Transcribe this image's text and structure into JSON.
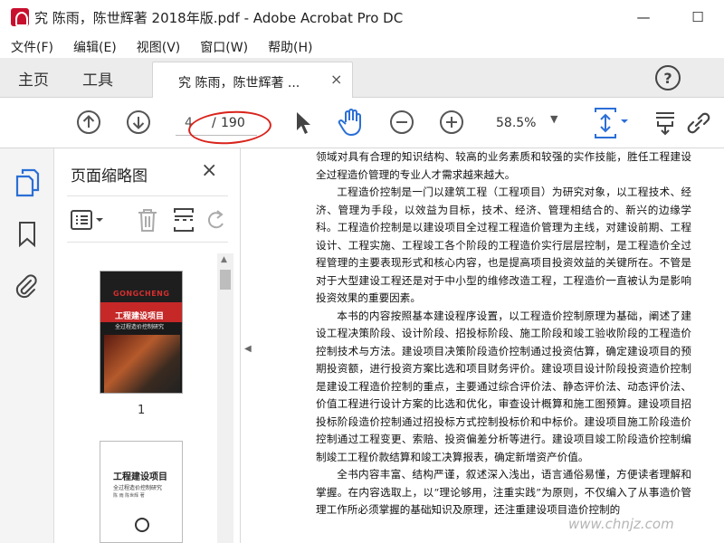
{
  "window": {
    "title": "究 陈雨，陈世辉著 2018年版.pdf - Adobe Acrobat Pro DC",
    "minimize": "—",
    "maximize": "☐"
  },
  "menu": [
    "文件(F)",
    "编辑(E)",
    "视图(V)",
    "窗口(W)",
    "帮助(H)"
  ],
  "tabs": {
    "home": "主页",
    "tools": "工具",
    "document": "究 陈雨，陈世辉著 ...",
    "close": "×",
    "help": "?"
  },
  "toolbar": {
    "page_current": "4",
    "page_separator": "/",
    "page_total": "190",
    "zoom": "58.5%",
    "zoom_caret": "▼"
  },
  "thumbnails": {
    "title": "页面缩略图",
    "close": "×",
    "page1_label": "1",
    "page1": {
      "brand": "GONGCHENG",
      "title": "工程建设项目",
      "subtitle": "全过程造价控制研究"
    },
    "page2": {
      "title": "工程建设项目",
      "subtitle": "全过程造价控制研究",
      "authors": "陈 雨  陈世辉 著"
    }
  },
  "document": {
    "paragraphs": [
      {
        "indent": false,
        "text": "领域对具有合理的知识结构、较高的业务素质和较强的实作技能，胜任工程建设全过程造价管理的专业人才需求越来越大。"
      },
      {
        "indent": true,
        "text": "工程造价控制是一门以建筑工程（工程项目）为研究对象，以工程技术、经济、管理为手段，以效益为目标，技术、经济、管理相结合的、新兴的边缘学科。工程造价控制是以建设项目全过程工程造价管理为主线，对建设前期、工程设计、工程实施、工程竣工各个阶段的工程造价实行层层控制，是工程造价全过程管理的主要表现形式和核心内容，也是提高项目投资效益的关键所在。不管是对于大型建设工程还是对于中小型的维修改造工程，工程造价一直被认为是影响投资效果的重要因素。"
      },
      {
        "indent": true,
        "text": "本书的内容按照基本建设程序设置，以工程造价控制原理为基础，阐述了建设工程决策阶段、设计阶段、招投标阶段、施工阶段和竣工验收阶段的工程造价控制技术与方法。建设项目决策阶段造价控制通过投资估算，确定建设项目的预期投资额，进行投资方案比选和项目财务评价。建设项目设计阶段投资造价控制是建设工程造价控制的重点，主要通过综合评价法、静态评价法、动态评价法、价值工程进行设计方案的比选和优化，审查设计概算和施工图预算。建设项目招投标阶段造价控制通过招投标方式控制投标价和中标价。建设项目施工阶段造价控制通过工程变更、索赔、投资偏差分析等进行。建设项目竣工阶段造价控制编制竣工工程价款结算和竣工决算报表，确定新增资产价值。"
      },
      {
        "indent": true,
        "text": "全书内容丰富、结构严谨，叙述深入浅出，语言通俗易懂，方便读者理解和掌握。在内容选取上，以“理论够用，注重实践”为原则，不仅编入了从事造价管理工作所必须掌握的基础知识及原理，还注重建设项目造价控制的"
      }
    ]
  },
  "watermark": "www.chnjz.com",
  "colors": {
    "accent_blue": "#2b6fd6",
    "annotation_red": "#d9231b",
    "tab_bar_bg": "#ececec"
  }
}
